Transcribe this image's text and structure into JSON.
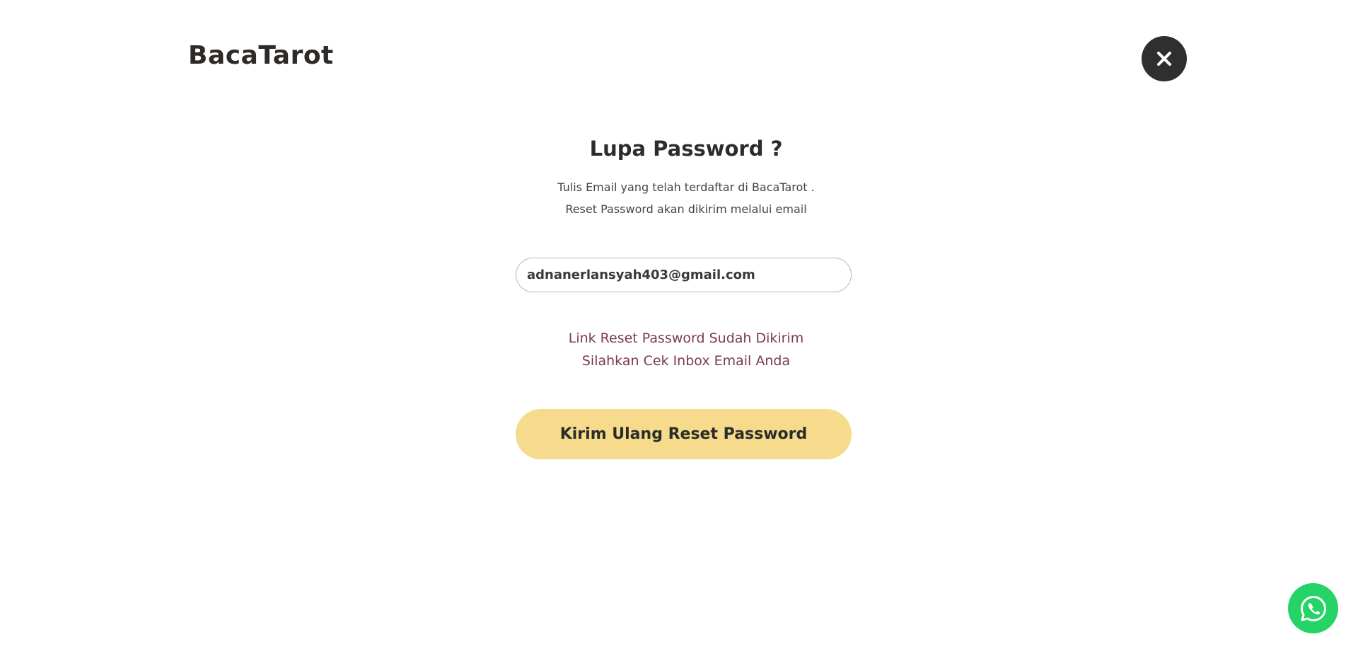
{
  "brand": {
    "name": "BacaTarot"
  },
  "header": {
    "close_icon": "close-icon"
  },
  "form": {
    "title": "Lupa Password ?",
    "description_line1": "Tulis Email yang telah terdaftar di BacaTarot .",
    "description_line2": "Reset Password akan dikirim melalui email",
    "email_value": "adnanerlansyah403@gmail.com",
    "status_line1": "Link Reset Password Sudah Dikirim",
    "status_line2": "Silahkan Cek Inbox Email Anda",
    "resend_label": "Kirim Ulang Reset Password"
  },
  "floating": {
    "whatsapp_icon": "whatsapp-icon"
  },
  "colors": {
    "button_bg": "#f5db8b",
    "status_text": "#7a3a55",
    "close_bg": "#2f2f2f",
    "whatsapp": "#25d366"
  }
}
